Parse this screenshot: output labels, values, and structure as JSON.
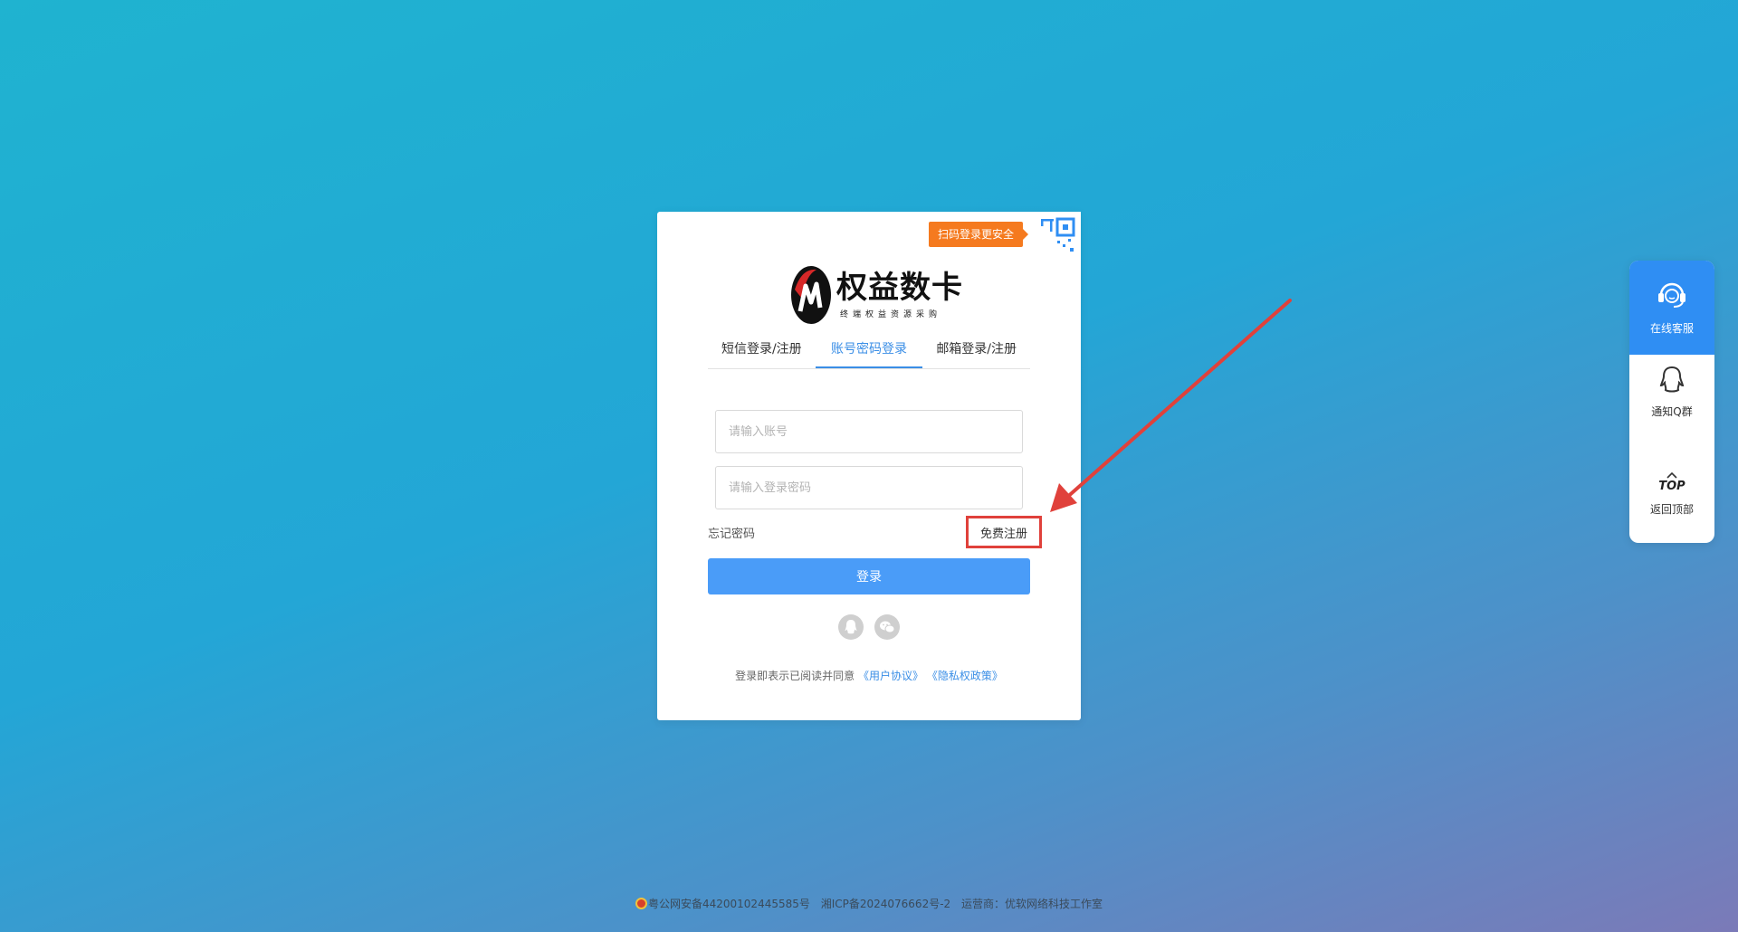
{
  "qr_tip": "扫码登录更安全",
  "logo": {
    "name": "权益数卡",
    "tagline": "终端权益资源采购"
  },
  "tabs": [
    {
      "label": "短信登录/注册",
      "active": false
    },
    {
      "label": "账号密码登录",
      "active": true
    },
    {
      "label": "邮箱登录/注册",
      "active": false
    }
  ],
  "form": {
    "account_placeholder": "请输入账号",
    "password_placeholder": "请输入登录密码",
    "forgot_label": "忘记密码",
    "register_label": "免费注册",
    "login_label": "登录"
  },
  "social": [
    "qq-icon",
    "wechat-icon"
  ],
  "agreement": {
    "prefix": "登录即表示已阅读并同意",
    "user_agreement": "《用户协议》",
    "privacy_policy": "《隐私权政策》"
  },
  "floatbar": {
    "service_label": "在线客服",
    "qq_group_label": "通知Q群",
    "top_text": "TOP",
    "back_top_label": "返回顶部"
  },
  "footer": {
    "police": "粤公网安备44200102445585号",
    "icp": "湘ICP备2024076662号-2",
    "operator": "运营商：优软网络科技工作室"
  },
  "colors": {
    "accent": "#3a8ee6",
    "button": "#4a9cf8",
    "tip": "#f57a1f",
    "annotation": "#e0413b"
  }
}
